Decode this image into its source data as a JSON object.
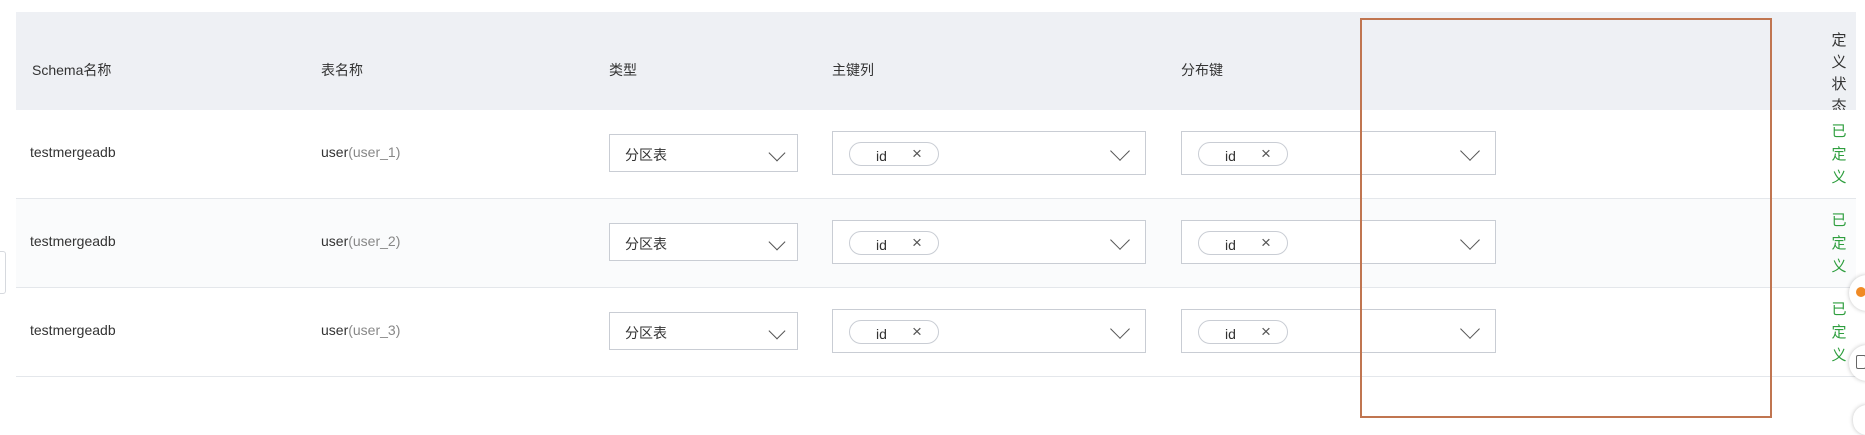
{
  "headers": {
    "schema": "Schema名称",
    "table": "表名称",
    "type": "类型",
    "pk": "主键列",
    "dist": "分布键",
    "status": [
      "定",
      "义",
      "状",
      "态"
    ]
  },
  "rows": [
    {
      "schema": "testmergeadb",
      "table_name": "user",
      "table_sub": "(user_1)",
      "type": "分区表",
      "pk_tag": "id",
      "dist_tag": "id",
      "status": [
        "已",
        "定",
        "义"
      ]
    },
    {
      "schema": "testmergeadb",
      "table_name": "user",
      "table_sub": "(user_2)",
      "type": "分区表",
      "pk_tag": "id",
      "dist_tag": "id",
      "status": [
        "已",
        "定",
        "义"
      ]
    },
    {
      "schema": "testmergeadb",
      "table_name": "user",
      "table_sub": "(user_3)",
      "type": "分区表",
      "pk_tag": "id",
      "dist_tag": "id",
      "status": [
        "已",
        "定",
        "义"
      ]
    }
  ],
  "tag_remove_glyph": "×",
  "colors": {
    "header_bg": "#eef0f4",
    "status_green": "#2e9e3e",
    "highlight_border": "#c07550"
  }
}
